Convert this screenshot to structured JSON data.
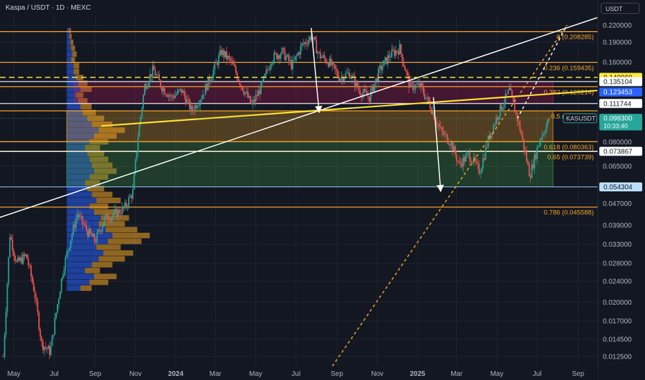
{
  "header": {
    "title": "Kaspa / USDT · 1D · MEXC",
    "currency": "USDT"
  },
  "colors": {
    "background": "#131722",
    "grid": "#1f2433",
    "fib": "#f5a623",
    "up": "#26a69a",
    "down": "#ef5350",
    "trendline": "#ffffff",
    "yellow_line": "#ffe135",
    "volume_profile": "#2962ff",
    "volume_profile_alt": "#f5a623"
  },
  "chart_data": {
    "type": "line",
    "y_scale": "log",
    "ylim": [
      0.0115,
      0.24
    ],
    "y_ticks": [
      "0.220000",
      "0.190000",
      "0.160000",
      "0.135104",
      "0.111744",
      "0.080000",
      "0.065000",
      "0.047000",
      "0.039000",
      "0.033000",
      "0.028000",
      "0.024000",
      "0.020000",
      "0.017000",
      "0.014500",
      "0.012500"
    ],
    "y_tick_values": [
      0.22,
      0.19,
      0.16,
      0.135104,
      0.111744,
      0.08,
      0.065,
      0.047,
      0.039,
      0.033,
      0.028,
      0.024,
      0.02,
      0.017,
      0.0145,
      0.0125
    ],
    "x_ticks": [
      "May",
      "Jul",
      "Sep",
      "Nov",
      "2024",
      "Mar",
      "May",
      "Jul",
      "Sep",
      "Nov",
      "2025",
      "Mar",
      "May",
      "Jul",
      "Sep"
    ],
    "x_tick_dates": [
      "2023-05-01",
      "2023-07-01",
      "2023-09-01",
      "2023-11-01",
      "2024-01-01",
      "2024-03-01",
      "2024-05-01",
      "2024-07-01",
      "2024-09-01",
      "2024-11-01",
      "2025-01-01",
      "2025-03-01",
      "2025-05-01",
      "2025-07-01",
      "2025-09-01"
    ],
    "x_bold": [
      "2024",
      "2025"
    ],
    "price_series": [
      [
        "2023-04-15",
        0.0125
      ],
      [
        "2023-04-25",
        0.036
      ],
      [
        "2023-05-05",
        0.028
      ],
      [
        "2023-05-20",
        0.03
      ],
      [
        "2023-06-01",
        0.022
      ],
      [
        "2023-06-12",
        0.014
      ],
      [
        "2023-06-25",
        0.013
      ],
      [
        "2023-07-05",
        0.019
      ],
      [
        "2023-07-15",
        0.027
      ],
      [
        "2023-07-25",
        0.034
      ],
      [
        "2023-08-05",
        0.043
      ],
      [
        "2023-08-20",
        0.037
      ],
      [
        "2023-09-01",
        0.034
      ],
      [
        "2023-09-15",
        0.041
      ],
      [
        "2023-10-01",
        0.043
      ],
      [
        "2023-10-15",
        0.045
      ],
      [
        "2023-10-28",
        0.052
      ],
      [
        "2023-11-05",
        0.085
      ],
      [
        "2023-11-15",
        0.13
      ],
      [
        "2023-11-28",
        0.15
      ],
      [
        "2023-12-10",
        0.13
      ],
      [
        "2023-12-25",
        0.118
      ],
      [
        "2024-01-10",
        0.125
      ],
      [
        "2024-01-25",
        0.105
      ],
      [
        "2024-02-10",
        0.12
      ],
      [
        "2024-02-25",
        0.145
      ],
      [
        "2024-03-10",
        0.175
      ],
      [
        "2024-03-25",
        0.16
      ],
      [
        "2024-04-10",
        0.13
      ],
      [
        "2024-04-25",
        0.11
      ],
      [
        "2024-05-10",
        0.13
      ],
      [
        "2024-05-25",
        0.165
      ],
      [
        "2024-06-10",
        0.175
      ],
      [
        "2024-06-25",
        0.155
      ],
      [
        "2024-07-10",
        0.185
      ],
      [
        "2024-07-25",
        0.2
      ],
      [
        "2024-08-05",
        0.17
      ],
      [
        "2024-08-20",
        0.16
      ],
      [
        "2024-09-05",
        0.14
      ],
      [
        "2024-09-20",
        0.145
      ],
      [
        "2024-10-05",
        0.125
      ],
      [
        "2024-10-20",
        0.118
      ],
      [
        "2024-11-05",
        0.15
      ],
      [
        "2024-11-20",
        0.17
      ],
      [
        "2024-12-05",
        0.18
      ],
      [
        "2024-12-20",
        0.13
      ],
      [
        "2025-01-05",
        0.13
      ],
      [
        "2025-01-20",
        0.11
      ],
      [
        "2025-02-05",
        0.088
      ],
      [
        "2025-02-20",
        0.08
      ],
      [
        "2025-03-05",
        0.066
      ],
      [
        "2025-03-20",
        0.072
      ],
      [
        "2025-04-05",
        0.062
      ],
      [
        "2025-04-20",
        0.085
      ],
      [
        "2025-05-05",
        0.105
      ],
      [
        "2025-05-20",
        0.125
      ],
      [
        "2025-06-05",
        0.09
      ],
      [
        "2025-06-20",
        0.06
      ],
      [
        "2025-07-05",
        0.082
      ],
      [
        "2025-07-20",
        0.0983
      ]
    ],
    "fib_levels": [
      {
        "label": "0 (0.208285)",
        "value": 0.208285
      },
      {
        "label": "0.236 (0.159435)",
        "value": 0.159435
      },
      {
        "label": "0.382 (0.129214)",
        "value": 0.129214
      },
      {
        "label": "0.5 (0.104838)",
        "value": 0.104838
      },
      {
        "label": "0.618 (0.080363)",
        "value": 0.080363
      },
      {
        "label": "0.65 (0.073739)",
        "value": 0.073739
      },
      {
        "label": "0.786 (0.045588)",
        "value": 0.045588
      }
    ],
    "price_labels": [
      {
        "text": "0.140060",
        "value": 0.14006,
        "style": "yellow"
      },
      {
        "text": "0.135104",
        "value": 0.135104,
        "style": "white"
      },
      {
        "text": "0.123453",
        "value": 0.123453,
        "style": "blue"
      },
      {
        "text": "0.111744",
        "value": 0.111744,
        "style": "white"
      },
      {
        "text": "0.098300",
        "value": 0.0983,
        "style": "teal"
      },
      {
        "text": "0.073867",
        "value": 0.073867,
        "style": "white"
      },
      {
        "text": "0.054304",
        "value": 0.054304,
        "style": "lightblue"
      }
    ],
    "current": {
      "symbol": "KASUSDT",
      "price": "0.098300",
      "countdown": "10:33:40"
    },
    "zones": [
      {
        "from": "2023-08-01",
        "to": "2025-07-25",
        "top": 0.135104,
        "bottom": 0.111744,
        "color": "#c2185b"
      },
      {
        "from": "2023-07-20",
        "to": "2025-07-25",
        "top": 0.104838,
        "bottom": 0.080363,
        "color": "#f5a623"
      },
      {
        "from": "2023-07-20",
        "to": "2025-07-25",
        "top": 0.080363,
        "bottom": 0.054304,
        "color": "#43a047"
      }
    ],
    "annotations": [
      {
        "kind": "trend",
        "color": "#ffffff",
        "from": [
          "2023-04-01",
          0.041
        ],
        "to": [
          "2025-09-30",
          0.235
        ],
        "style": "solid"
      },
      {
        "kind": "trend",
        "color": "#ffe135",
        "from": [
          "2023-09-10",
          0.092
        ],
        "to": [
          "2025-09-30",
          0.125
        ],
        "style": "solid"
      },
      {
        "kind": "trend",
        "color": "#f5a623",
        "from": [
          "2024-08-25",
          0.0115
        ],
        "to": [
          "2025-08-15",
          0.22
        ],
        "style": "dashed"
      },
      {
        "kind": "trend",
        "color": "#ffffff",
        "from": [
          "2025-06-01",
          0.098
        ],
        "to": [
          "2025-08-15",
          0.22
        ],
        "style": "dashed"
      },
      {
        "kind": "arrow",
        "color": "#ffffff",
        "from": [
          "2024-07-24",
          0.215
        ],
        "to": [
          "2024-08-05",
          0.104
        ]
      },
      {
        "kind": "arrow",
        "color": "#ffffff",
        "from": [
          "2025-01-25",
          0.118
        ],
        "to": [
          "2025-02-05",
          0.0525
        ]
      },
      {
        "kind": "hline",
        "color": "#ffe135",
        "value": 0.14006,
        "style": "dashed"
      }
    ],
    "volume_profile": [
      0.3,
      0.5,
      0.6,
      0.4,
      0.55,
      0.7,
      0.8,
      0.65,
      0.9,
      1.0,
      0.85,
      0.7,
      0.75,
      0.6,
      0.5,
      0.65,
      0.55,
      0.45,
      0.4,
      0.5,
      0.6,
      0.55,
      0.5,
      0.45,
      0.4,
      0.5,
      0.6,
      0.7,
      0.55,
      0.45,
      0.35,
      0.3,
      0.25,
      0.2,
      0.3,
      0.25,
      0.2,
      0.15,
      0.15,
      0.1,
      0.12,
      0.1,
      0.08,
      0.06,
      0.05
    ]
  }
}
